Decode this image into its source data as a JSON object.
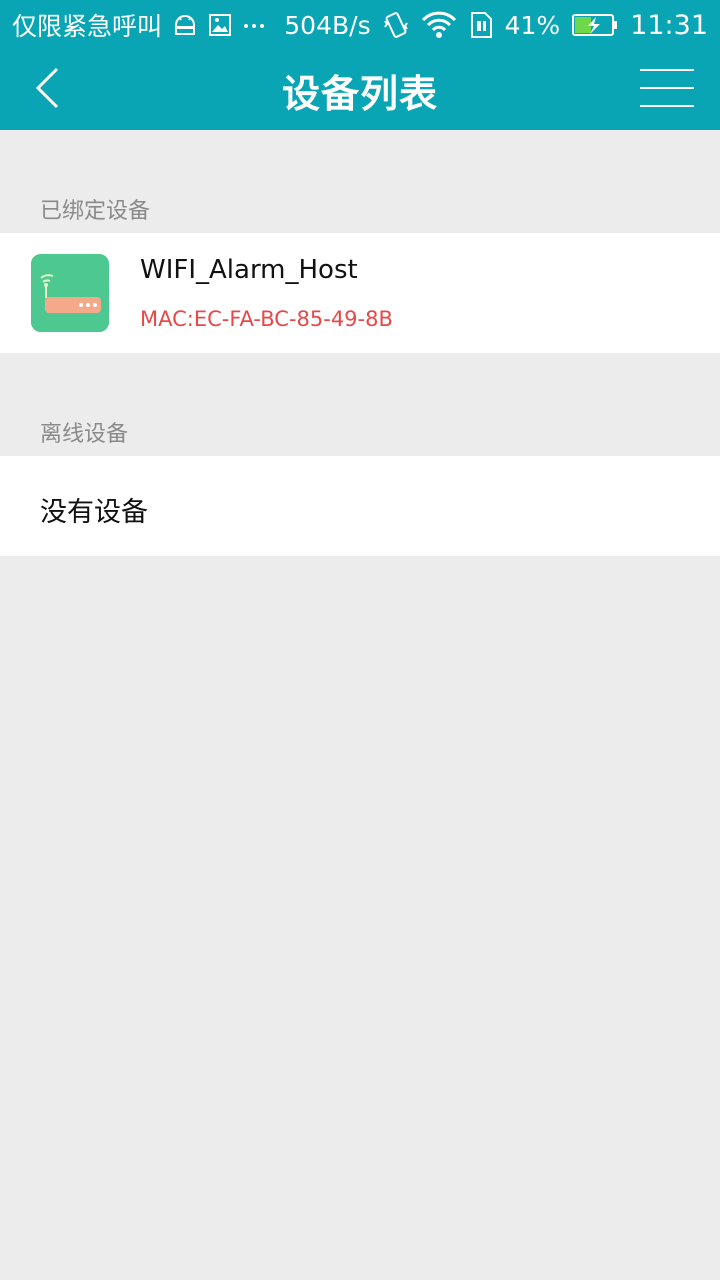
{
  "status_bar": {
    "carrier": "仅限紧急呼叫",
    "net_speed": "504B/s",
    "battery": "41%",
    "time": "11:31",
    "icons": [
      "android-icon",
      "image-icon",
      "more-icon",
      "vibrate-icon",
      "wifi-icon",
      "sim-icon",
      "battery-charging-icon"
    ]
  },
  "header": {
    "title": "设备列表",
    "back_icon": "chevron-left-icon",
    "menu_icon": "menu-icon"
  },
  "bound_section": {
    "label": "已绑定设备",
    "devices": [
      {
        "name": "WIFI_Alarm_Host",
        "mac": "MAC:EC-FA-BC-85-49-8B",
        "icon": "router-icon"
      }
    ]
  },
  "offline_section": {
    "label": "离线设备",
    "empty_text": "没有设备"
  },
  "colors": {
    "accent": "#0aa5b5",
    "mac_text": "#e84848",
    "icon_bg": "#4cc890",
    "background": "#ececec"
  }
}
